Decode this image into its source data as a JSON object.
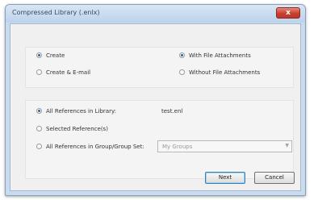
{
  "window": {
    "title": "Compressed Library (.enlx)",
    "close_label": "x"
  },
  "format_options": {
    "create_label": "Create",
    "create_email_label": "Create & E-mail",
    "selected": "create"
  },
  "attachment_options": {
    "with_label": "With File Attachments",
    "without_label": "Without File Attachments",
    "selected": "with"
  },
  "reference_options": {
    "all_label": "All References in Library:",
    "library_name": "test.enl",
    "selected_label": "Selected Reference(s)",
    "group_label": "All References in Group/Group Set:",
    "selected": "all"
  },
  "group_select": {
    "value": "My Groups",
    "arrow_icon": "chevron-down-icon"
  },
  "buttons": {
    "next_label": "Next",
    "cancel_label": "Cancel"
  }
}
